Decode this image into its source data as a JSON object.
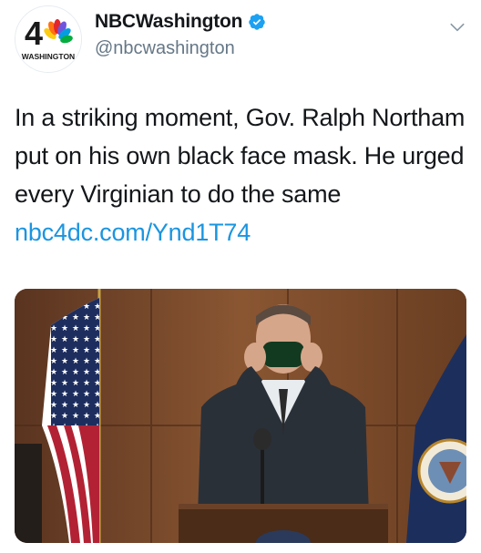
{
  "author": {
    "display_name": "NBCWashington",
    "handle": "@nbcwashington",
    "verified": true,
    "avatar_icon": "nbc4-washington-logo",
    "avatar_number": "4",
    "avatar_label": "WASHINGTON"
  },
  "tweet": {
    "text": "In a striking moment, Gov. Ralph Northam put on his own black face mask. He urged every Virginian to do the same ",
    "link_text": "nbc4dc.com/Ynd1T74"
  },
  "media": {
    "kind": "photo",
    "icons": [
      "american-flag",
      "virginia-flag",
      "podium",
      "microphone"
    ]
  },
  "colors": {
    "link": "#1b95e0",
    "verified": "#1da1f2",
    "handle": "#657786",
    "text": "#14171a"
  }
}
